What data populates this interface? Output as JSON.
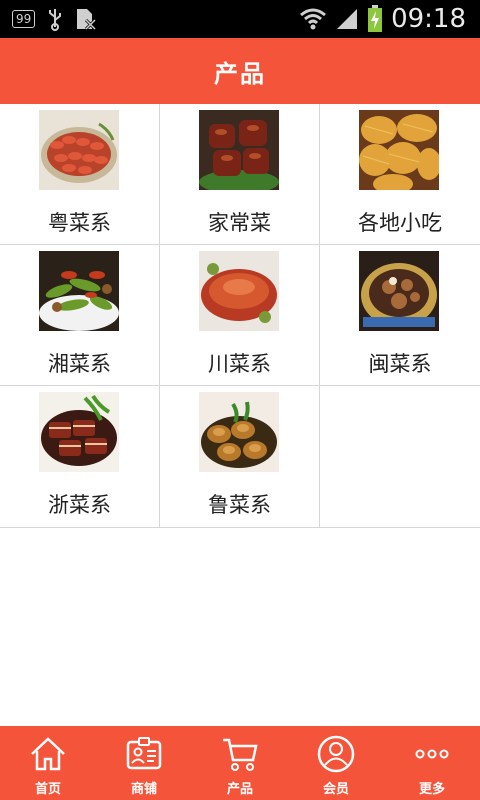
{
  "status_bar": {
    "notification_badge": "99",
    "time": "09:18",
    "icons": [
      "notification-count-icon",
      "usb-icon",
      "sim-card-icon",
      "wifi-icon",
      "signal-icon",
      "battery-charging-icon"
    ]
  },
  "header": {
    "title": "产品"
  },
  "categories": [
    {
      "label": "粤菜系",
      "image": "steamed-shrimp-dish"
    },
    {
      "label": "家常菜",
      "image": "braised-pork-dish"
    },
    {
      "label": "各地小吃",
      "image": "fried-pastry-snack"
    },
    {
      "label": "湘菜系",
      "image": "stir-fried-peppers-dish"
    },
    {
      "label": "川菜系",
      "image": "roast-pig-dish"
    },
    {
      "label": "闽菜系",
      "image": "buddha-jumps-wall-dish"
    },
    {
      "label": "浙菜系",
      "image": "dongpo-pork-dish"
    },
    {
      "label": "鲁菜系",
      "image": "abalone-dish"
    }
  ],
  "bottom_nav": [
    {
      "label": "首页",
      "icon": "home-icon"
    },
    {
      "label": "商铺",
      "icon": "store-card-icon"
    },
    {
      "label": "产品",
      "icon": "cart-icon"
    },
    {
      "label": "会员",
      "icon": "member-icon"
    },
    {
      "label": "更多",
      "icon": "more-icon"
    }
  ],
  "colors": {
    "accent": "#f4553a",
    "grid_line": "#d6d6d6",
    "text": "#222222"
  }
}
